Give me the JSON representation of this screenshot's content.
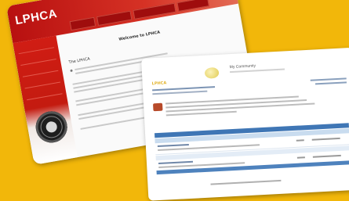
{
  "lphca": {
    "logo": "LPHCA",
    "welcome": "Welcome to LPHCA",
    "intro": "The LPHCA"
  },
  "forum": {
    "site_name": "My Community",
    "section": "LPHCA"
  },
  "colors": {
    "background": "#f2b70a",
    "lphca_red": "#c41b10",
    "forum_blue": "#3f76b5",
    "forum_accent": "#e2b32b"
  }
}
